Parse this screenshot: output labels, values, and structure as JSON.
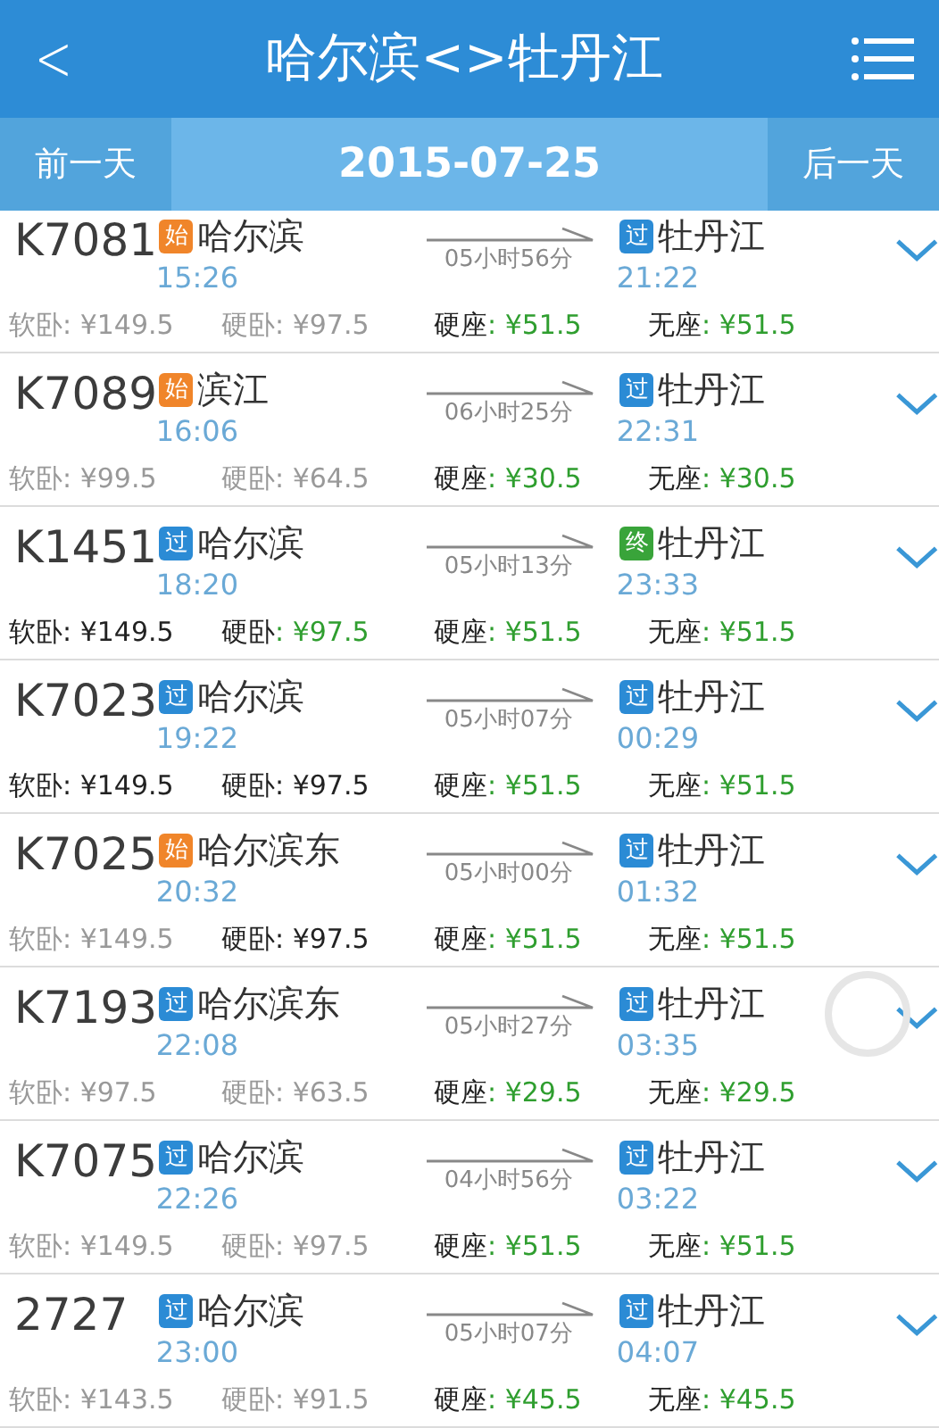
{
  "header": {
    "back": "<",
    "title": "哈尔滨<>牡丹江"
  },
  "date_bar": {
    "prev": "前一天",
    "date": "2015-07-25",
    "next": "后一天"
  },
  "trains": [
    {
      "number": "K7081",
      "from": {
        "badge": "始",
        "kind": "start",
        "name": "哈尔滨",
        "time": "15:26"
      },
      "duration": "05小时56分",
      "to": {
        "badge": "过",
        "kind": "pass",
        "name": "牡丹江",
        "time": "21:22"
      },
      "seats": [
        {
          "label": "软卧",
          "price": ": ¥149.5",
          "disabled": true,
          "highlighted": false
        },
        {
          "label": "硬卧",
          "price": ": ¥97.5",
          "disabled": true,
          "highlighted": false
        },
        {
          "label": "硬座",
          "price": ": ¥51.5",
          "disabled": false,
          "highlighted": true
        },
        {
          "label": "无座",
          "price": ": ¥51.5",
          "disabled": false,
          "highlighted": true
        }
      ]
    },
    {
      "number": "K7089",
      "from": {
        "badge": "始",
        "kind": "start",
        "name": "滨江",
        "time": "16:06"
      },
      "duration": "06小时25分",
      "to": {
        "badge": "过",
        "kind": "pass",
        "name": "牡丹江",
        "time": "22:31"
      },
      "seats": [
        {
          "label": "软卧",
          "price": ": ¥99.5",
          "disabled": true,
          "highlighted": false
        },
        {
          "label": "硬卧",
          "price": ": ¥64.5",
          "disabled": true,
          "highlighted": false
        },
        {
          "label": "硬座",
          "price": ": ¥30.5",
          "disabled": false,
          "highlighted": true
        },
        {
          "label": "无座",
          "price": ": ¥30.5",
          "disabled": false,
          "highlighted": true
        }
      ]
    },
    {
      "number": "K1451",
      "from": {
        "badge": "过",
        "kind": "pass",
        "name": "哈尔滨",
        "time": "18:20"
      },
      "duration": "05小时13分",
      "to": {
        "badge": "终",
        "kind": "end",
        "name": "牡丹江",
        "time": "23:33"
      },
      "seats": [
        {
          "label": "软卧",
          "price": ": ¥149.5",
          "disabled": false,
          "highlighted": false
        },
        {
          "label": "硬卧",
          "price": ": ¥97.5",
          "disabled": false,
          "highlighted": true
        },
        {
          "label": "硬座",
          "price": ": ¥51.5",
          "disabled": false,
          "highlighted": true
        },
        {
          "label": "无座",
          "price": ": ¥51.5",
          "disabled": false,
          "highlighted": true
        }
      ]
    },
    {
      "number": "K7023",
      "from": {
        "badge": "过",
        "kind": "pass",
        "name": "哈尔滨",
        "time": "19:22"
      },
      "duration": "05小时07分",
      "to": {
        "badge": "过",
        "kind": "pass",
        "name": "牡丹江",
        "time": "00:29"
      },
      "seats": [
        {
          "label": "软卧",
          "price": ": ¥149.5",
          "disabled": false,
          "highlighted": false
        },
        {
          "label": "硬卧",
          "price": ": ¥97.5",
          "disabled": false,
          "highlighted": false
        },
        {
          "label": "硬座",
          "price": ": ¥51.5",
          "disabled": false,
          "highlighted": true
        },
        {
          "label": "无座",
          "price": ": ¥51.5",
          "disabled": false,
          "highlighted": true
        }
      ]
    },
    {
      "number": "K7025",
      "from": {
        "badge": "始",
        "kind": "start",
        "name": "哈尔滨东",
        "time": "20:32"
      },
      "duration": "05小时00分",
      "to": {
        "badge": "过",
        "kind": "pass",
        "name": "牡丹江",
        "time": "01:32"
      },
      "seats": [
        {
          "label": "软卧",
          "price": ": ¥149.5",
          "disabled": true,
          "highlighted": false
        },
        {
          "label": "硬卧",
          "price": ": ¥97.5",
          "disabled": false,
          "highlighted": false
        },
        {
          "label": "硬座",
          "price": ": ¥51.5",
          "disabled": false,
          "highlighted": true
        },
        {
          "label": "无座",
          "price": ": ¥51.5",
          "disabled": false,
          "highlighted": true
        }
      ]
    },
    {
      "number": "K7193",
      "from": {
        "badge": "过",
        "kind": "pass",
        "name": "哈尔滨东",
        "time": "22:08"
      },
      "duration": "05小时27分",
      "to": {
        "badge": "过",
        "kind": "pass",
        "name": "牡丹江",
        "time": "03:35"
      },
      "seats": [
        {
          "label": "软卧",
          "price": ": ¥97.5",
          "disabled": true,
          "highlighted": false
        },
        {
          "label": "硬卧",
          "price": ": ¥63.5",
          "disabled": true,
          "highlighted": false
        },
        {
          "label": "硬座",
          "price": ": ¥29.5",
          "disabled": false,
          "highlighted": true
        },
        {
          "label": "无座",
          "price": ": ¥29.5",
          "disabled": false,
          "highlighted": true
        }
      ]
    },
    {
      "number": "K7075",
      "from": {
        "badge": "过",
        "kind": "pass",
        "name": "哈尔滨",
        "time": "22:26"
      },
      "duration": "04小时56分",
      "to": {
        "badge": "过",
        "kind": "pass",
        "name": "牡丹江",
        "time": "03:22"
      },
      "seats": [
        {
          "label": "软卧",
          "price": ": ¥149.5",
          "disabled": true,
          "highlighted": false
        },
        {
          "label": "硬卧",
          "price": ": ¥97.5",
          "disabled": true,
          "highlighted": false
        },
        {
          "label": "硬座",
          "price": ": ¥51.5",
          "disabled": false,
          "highlighted": true
        },
        {
          "label": "无座",
          "price": ": ¥51.5",
          "disabled": false,
          "highlighted": true
        }
      ]
    },
    {
      "number": "2727",
      "from": {
        "badge": "过",
        "kind": "pass",
        "name": "哈尔滨",
        "time": "23:00"
      },
      "duration": "05小时07分",
      "to": {
        "badge": "过",
        "kind": "pass",
        "name": "牡丹江",
        "time": "04:07"
      },
      "seats": [
        {
          "label": "软卧",
          "price": ": ¥143.5",
          "disabled": true,
          "highlighted": false
        },
        {
          "label": "硬卧",
          "price": ": ¥91.5",
          "disabled": true,
          "highlighted": false
        },
        {
          "label": "硬座",
          "price": ": ¥45.5",
          "disabled": false,
          "highlighted": true
        },
        {
          "label": "无座",
          "price": ": ¥45.5",
          "disabled": false,
          "highlighted": true
        }
      ]
    }
  ]
}
